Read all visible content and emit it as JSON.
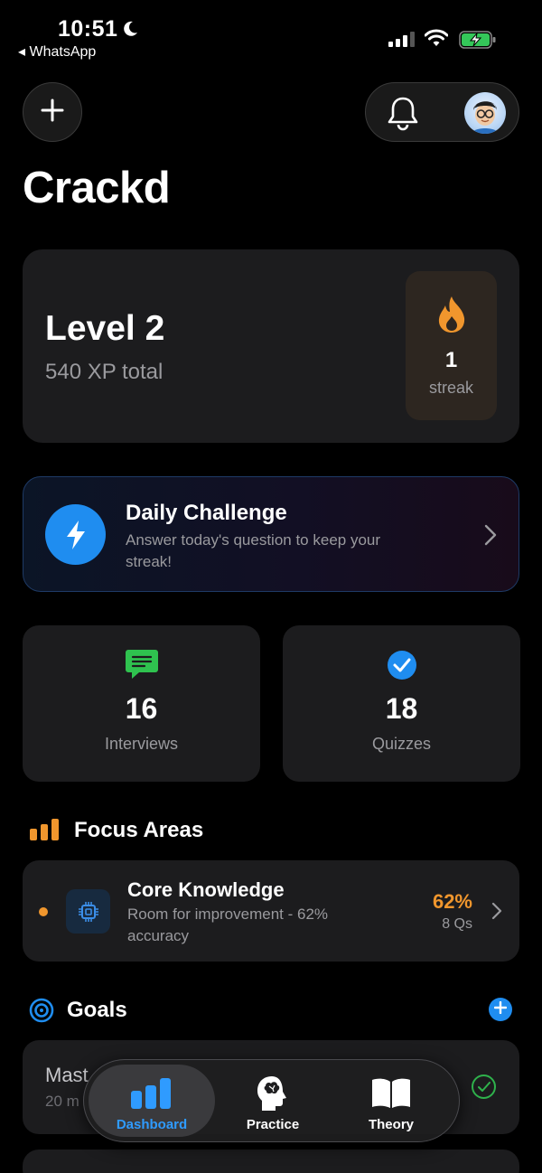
{
  "status_bar": {
    "time": "10:51",
    "back_app": "◂ WhatsApp"
  },
  "header": {
    "title": "Crackd"
  },
  "level_card": {
    "level": "Level 2",
    "xp": "540 XP total",
    "streak_count": "1",
    "streak_label": "streak"
  },
  "daily_challenge": {
    "title": "Daily Challenge",
    "subtitle": "Answer today's question to keep your streak!"
  },
  "stats": [
    {
      "value": "16",
      "label": "Interviews",
      "icon": "chat-bubble-icon"
    },
    {
      "value": "18",
      "label": "Quizzes",
      "icon": "checkmark-circle-icon"
    }
  ],
  "focus_areas": {
    "title": "Focus Areas",
    "items": [
      {
        "title": "Core Knowledge",
        "subtitle": "Room for improvement - 62% accuracy",
        "percent": "62%",
        "questions": "8 Qs"
      }
    ]
  },
  "goals": {
    "title": "Goals",
    "items": [
      {
        "title": "Mast",
        "subtitle": "20 m"
      }
    ]
  },
  "tabbar": {
    "tabs": [
      {
        "label": "Dashboard",
        "active": true
      },
      {
        "label": "Practice",
        "active": false
      },
      {
        "label": "Theory",
        "active": false
      }
    ]
  },
  "colors": {
    "accent_blue": "#1f8df0",
    "orange": "#f0962d",
    "green": "#2fb24c",
    "card": "#1c1c1e"
  }
}
